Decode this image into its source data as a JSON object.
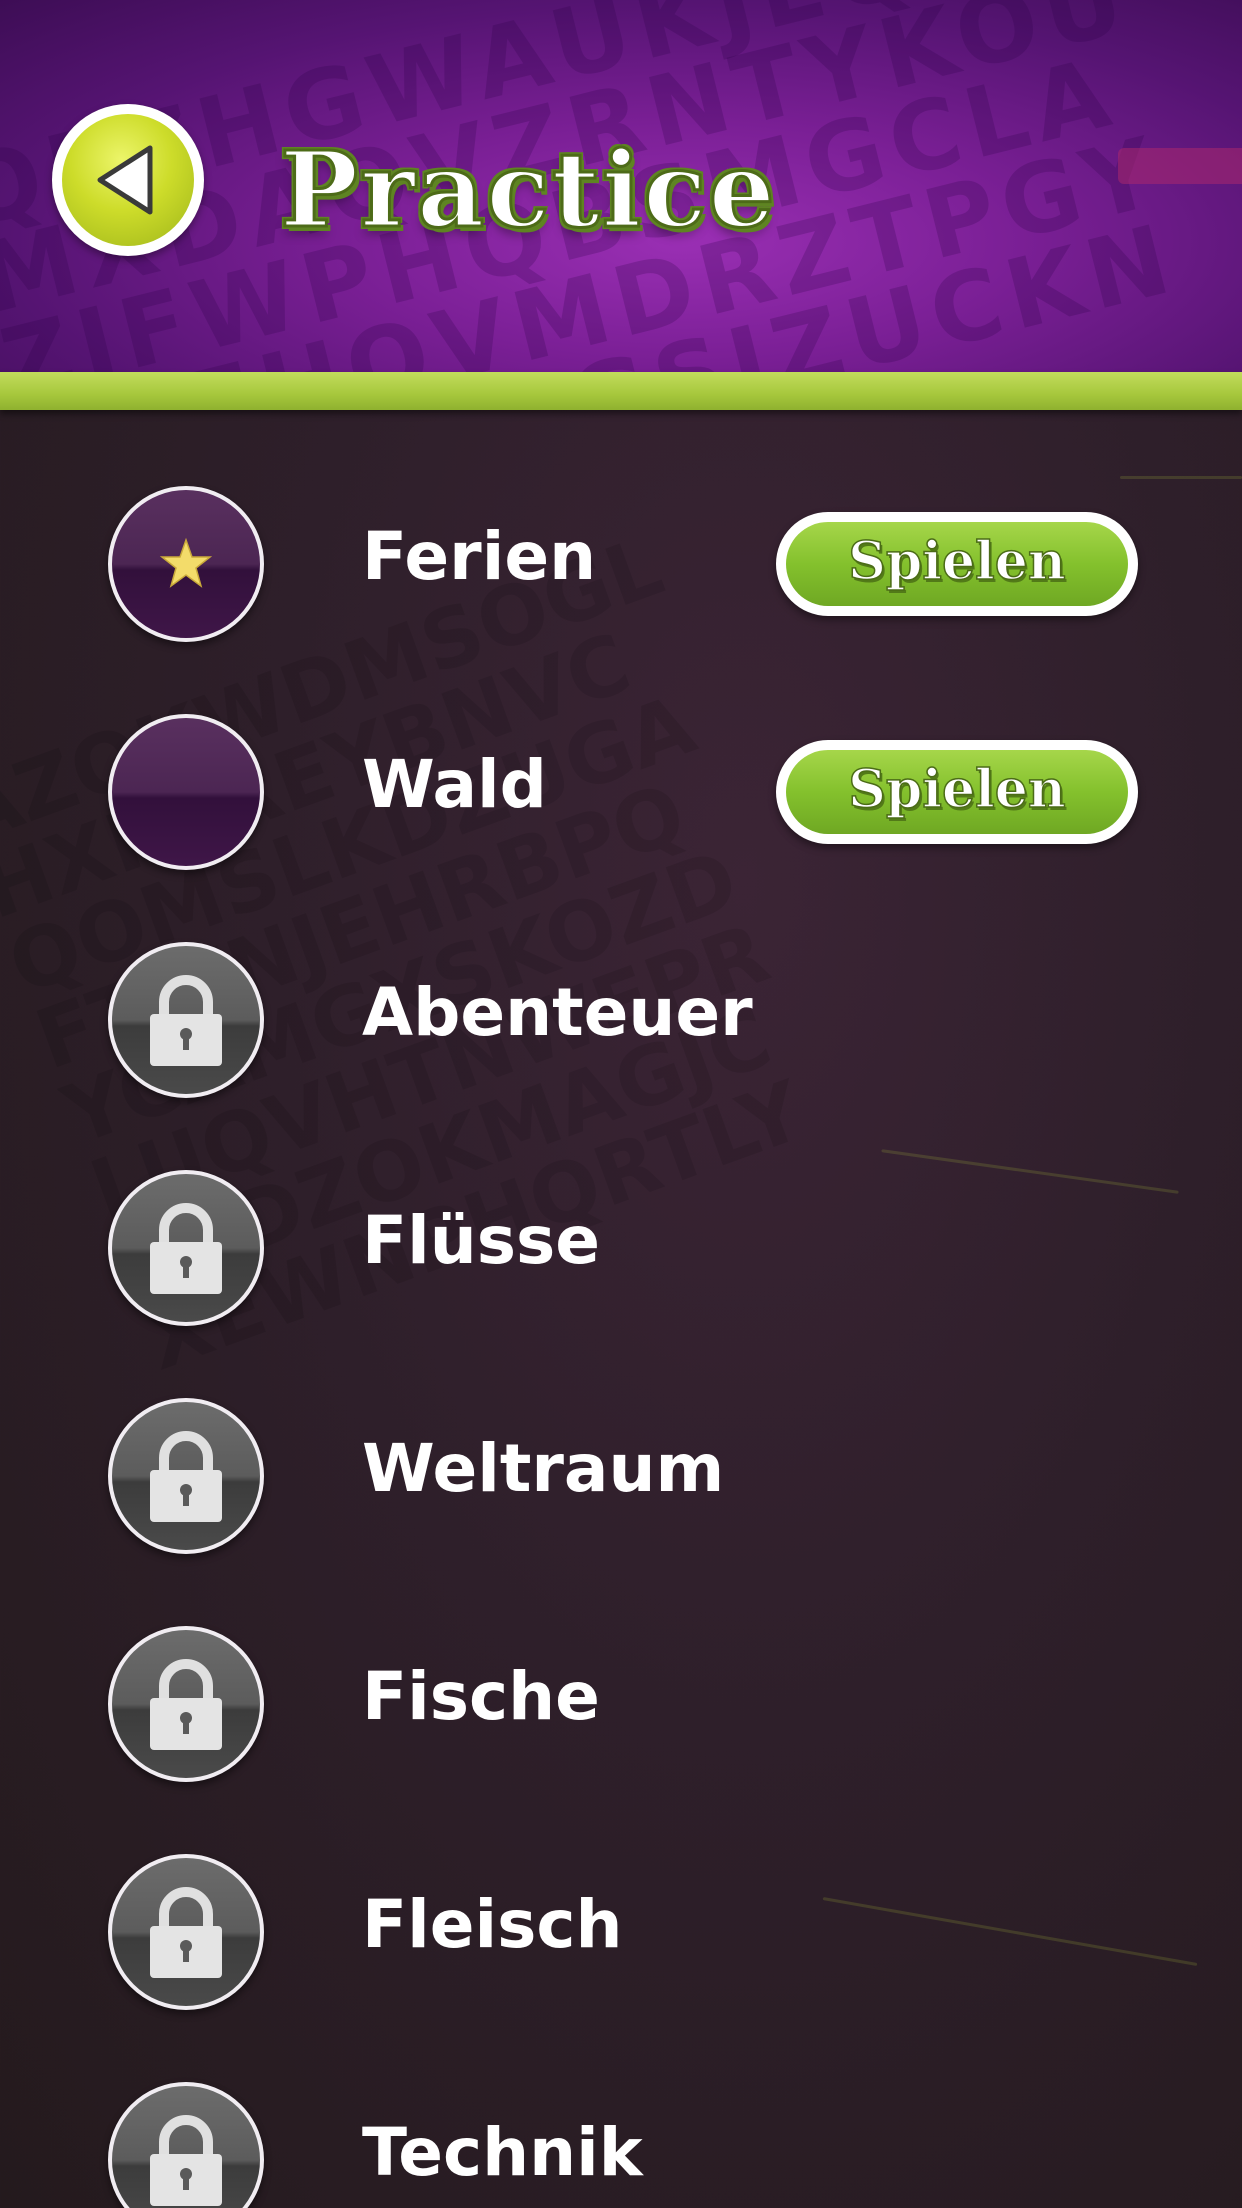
{
  "header": {
    "title": "Practice",
    "back_icon": "triangle-left-icon"
  },
  "colors": {
    "header_purple": "#7a1f95",
    "accent_green": "#a6c73c",
    "play_green": "#84c12d",
    "row_purple": "#4c2653",
    "locked_gray": "#5c5c5c"
  },
  "levels": [
    {
      "name": "Ferien",
      "status": "unlocked-star",
      "icon": "star-icon",
      "action": "Spielen"
    },
    {
      "name": "Wald",
      "status": "unlocked",
      "icon": "empty-circle-icon",
      "action": "Spielen"
    },
    {
      "name": "Abenteuer",
      "status": "locked",
      "icon": "lock-icon"
    },
    {
      "name": "Flüsse",
      "status": "locked",
      "icon": "lock-icon"
    },
    {
      "name": "Weltraum",
      "status": "locked",
      "icon": "lock-icon"
    },
    {
      "name": "Fische",
      "status": "locked",
      "icon": "lock-icon"
    },
    {
      "name": "Fleisch",
      "status": "locked",
      "icon": "lock-icon"
    },
    {
      "name": "Technik",
      "status": "locked",
      "icon": "lock-icon"
    }
  ]
}
